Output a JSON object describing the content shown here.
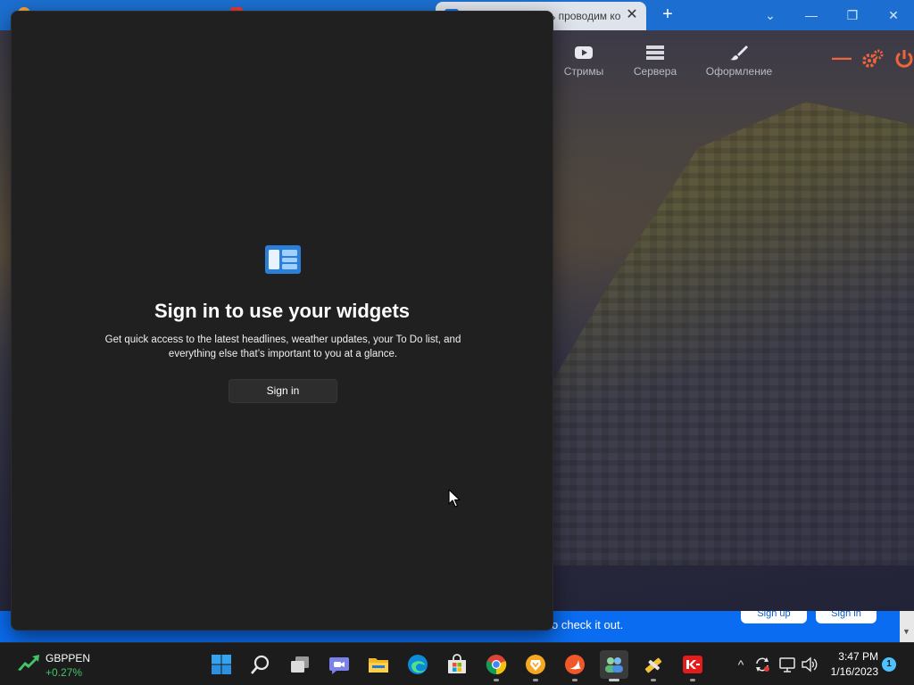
{
  "browser": {
    "active_tab_title": "ь проводим ко",
    "tab_close": "✕",
    "new_tab": "+",
    "window_controls": {
      "tabs_menu": "⌄",
      "minimize": "—",
      "restore": "❐",
      "close": "✕"
    },
    "game_nav": [
      {
        "label": "Стримы",
        "icon": "youtube-icon"
      },
      {
        "label": "Сервера",
        "icon": "server-icon"
      },
      {
        "label": "Оформление",
        "icon": "brush-icon"
      }
    ],
    "game_controls": {
      "minimize": "—",
      "settings": "gears-icon",
      "power": "power-icon"
    },
    "banner": {
      "text": "o check it out.",
      "signup_label": "Sign up",
      "signin_label": "Sign in"
    },
    "scroll_arrow": "▼"
  },
  "widgets": {
    "title": "Sign in to use your widgets",
    "description": "Get quick access to the latest headlines, weather updates, your To Do list, and everything else that’s important to you at a glance.",
    "signin_button": "Sign in"
  },
  "taskbar": {
    "stock_symbol": "GBPPEN",
    "stock_change": "+0.27%",
    "apps": [
      {
        "name": "start-button"
      },
      {
        "name": "search"
      },
      {
        "name": "task-view"
      },
      {
        "name": "teams-chat"
      },
      {
        "name": "file-explorer"
      },
      {
        "name": "edge"
      },
      {
        "name": "microsoft-store"
      },
      {
        "name": "chrome",
        "running": true
      },
      {
        "name": "brave",
        "running": true
      },
      {
        "name": "swift",
        "running": true
      },
      {
        "name": "people",
        "running": true,
        "active": true
      },
      {
        "name": "tool",
        "running": true
      },
      {
        "name": "red-app",
        "running": true
      }
    ],
    "tray": {
      "chevron": "^"
    },
    "time": "3:47 PM",
    "date": "1/16/2023",
    "notifications": "1"
  },
  "colors": {
    "tabstrip": "#1c6fd0",
    "widgets_bg": "#202020",
    "taskbar_bg": "#1c1c1c",
    "stock_positive": "#44c46a",
    "accent_red": "#f0643c"
  }
}
